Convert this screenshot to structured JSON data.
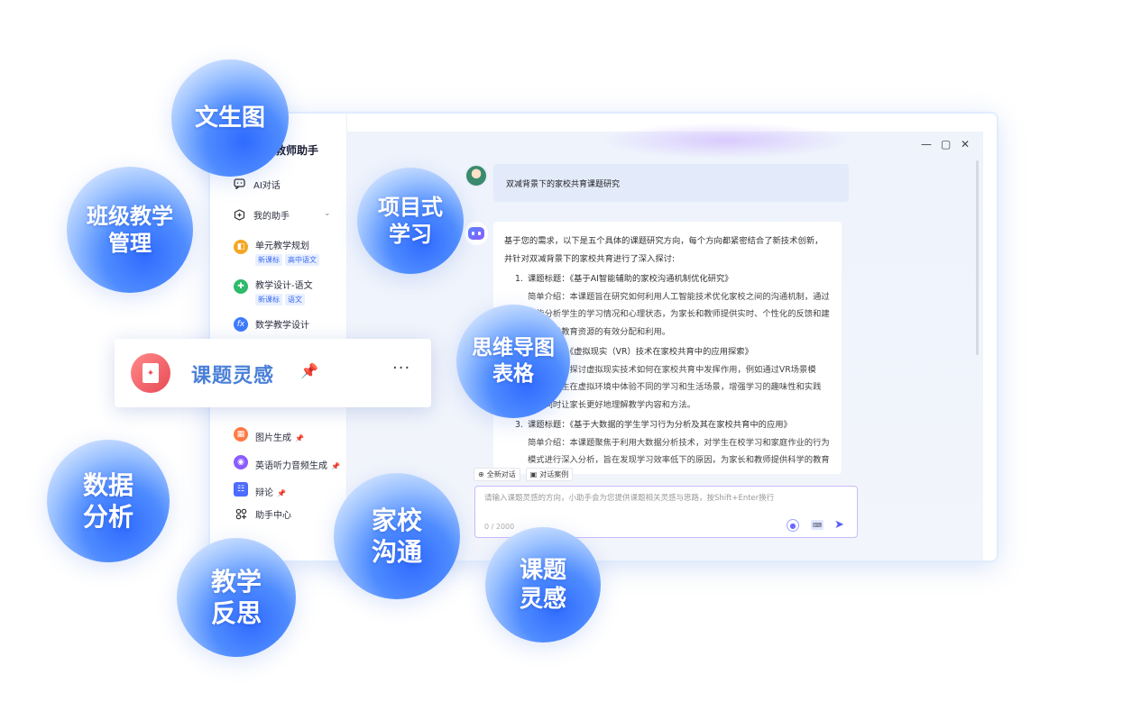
{
  "app": {
    "brand": "星火教师助手",
    "window_controls": [
      "—",
      "▢",
      "✕"
    ]
  },
  "sidebar": {
    "ai_chat": "AI对话",
    "my_assistant": "我的助手",
    "agents": [
      {
        "name": "单元教学规划",
        "tags": [
          "新课标",
          "高中语文"
        ],
        "color": "#f5a623"
      },
      {
        "name": "教学设计-语文",
        "tags": [
          "新课标",
          "语文"
        ],
        "color": "#2dbb6a"
      },
      {
        "name": "数学教学设计",
        "tags": [],
        "color": "#3d7bff"
      },
      {
        "name": "图片生成",
        "tags": [],
        "color": "#ff7a45",
        "pin": "📌"
      },
      {
        "name": "英语听力音频生成",
        "tags": [],
        "color": "#8b5cff",
        "pin": "📌"
      },
      {
        "name": "辩论",
        "tags": [],
        "color": "#4d6cff",
        "pin": "📌"
      }
    ],
    "help_center": "助手中心"
  },
  "chat": {
    "user_message": "双减背景下的家校共育课题研究",
    "answer_intro": "基于您的需求，以下是五个具体的课题研究方向，每个方向都紧密结合了新技术创新，并针对双减背景下的家校共育进行了深入探讨:",
    "items": [
      {
        "num": "1.",
        "title": "课题标题：《基于AI智能辅助的家校沟通机制优化研究》",
        "desc": "简单介绍：本课题旨在研究如何利用人工智能技术优化家校之间的沟通机制，通过智能分析学生的学习情况和心理状态，为家长和教师提供实时、个性化的反馈和建议，促进教育资源的有效分配和利用。"
      },
      {
        "num": "2.",
        "title": "课题标题：《虚拟现实（VR）技术在家校共育中的应用探索》",
        "desc": "简单介绍：探讨虚拟现实技术如何在家校共育中发挥作用，例如通过VR场景模拟，让学生在虚拟环境中体验不同的学习和生活场景，增强学习的趣味性和实践性，同时让家长更好地理解教学内容和方法。"
      },
      {
        "num": "3.",
        "title": "课题标题：《基于大数据的学生学习行为分析及其在家校共育中的应用》",
        "desc": "简单介绍：本课题聚焦于利用大数据分析技术，对学生在校学习和家庭作业的行为模式进行深入分析，旨在发现学习效率低下的原因，为家长和教师提供科学的教育指导"
      }
    ],
    "tools": [
      {
        "icon": "⊕",
        "label": "全新对话"
      },
      {
        "icon": "▣",
        "label": "对话案例"
      }
    ],
    "input_placeholder": "请输入课题灵感的方向，小助手会为您提供课题相关灵感与思路，按Shift+Enter换行",
    "counter": "0 / 2000"
  },
  "float_card": {
    "title": "课题灵感",
    "pin_icon": "📌",
    "more": "···"
  },
  "bubbles": [
    {
      "label": "文生图"
    },
    {
      "label": "班级教学\n管理"
    },
    {
      "label": "项目式\n学习"
    },
    {
      "label": "思维导图\n表格"
    },
    {
      "label": "数据\n分析"
    },
    {
      "label": "家校\n沟通"
    },
    {
      "label": "教学\n反思"
    },
    {
      "label": "课题\n灵感"
    }
  ]
}
